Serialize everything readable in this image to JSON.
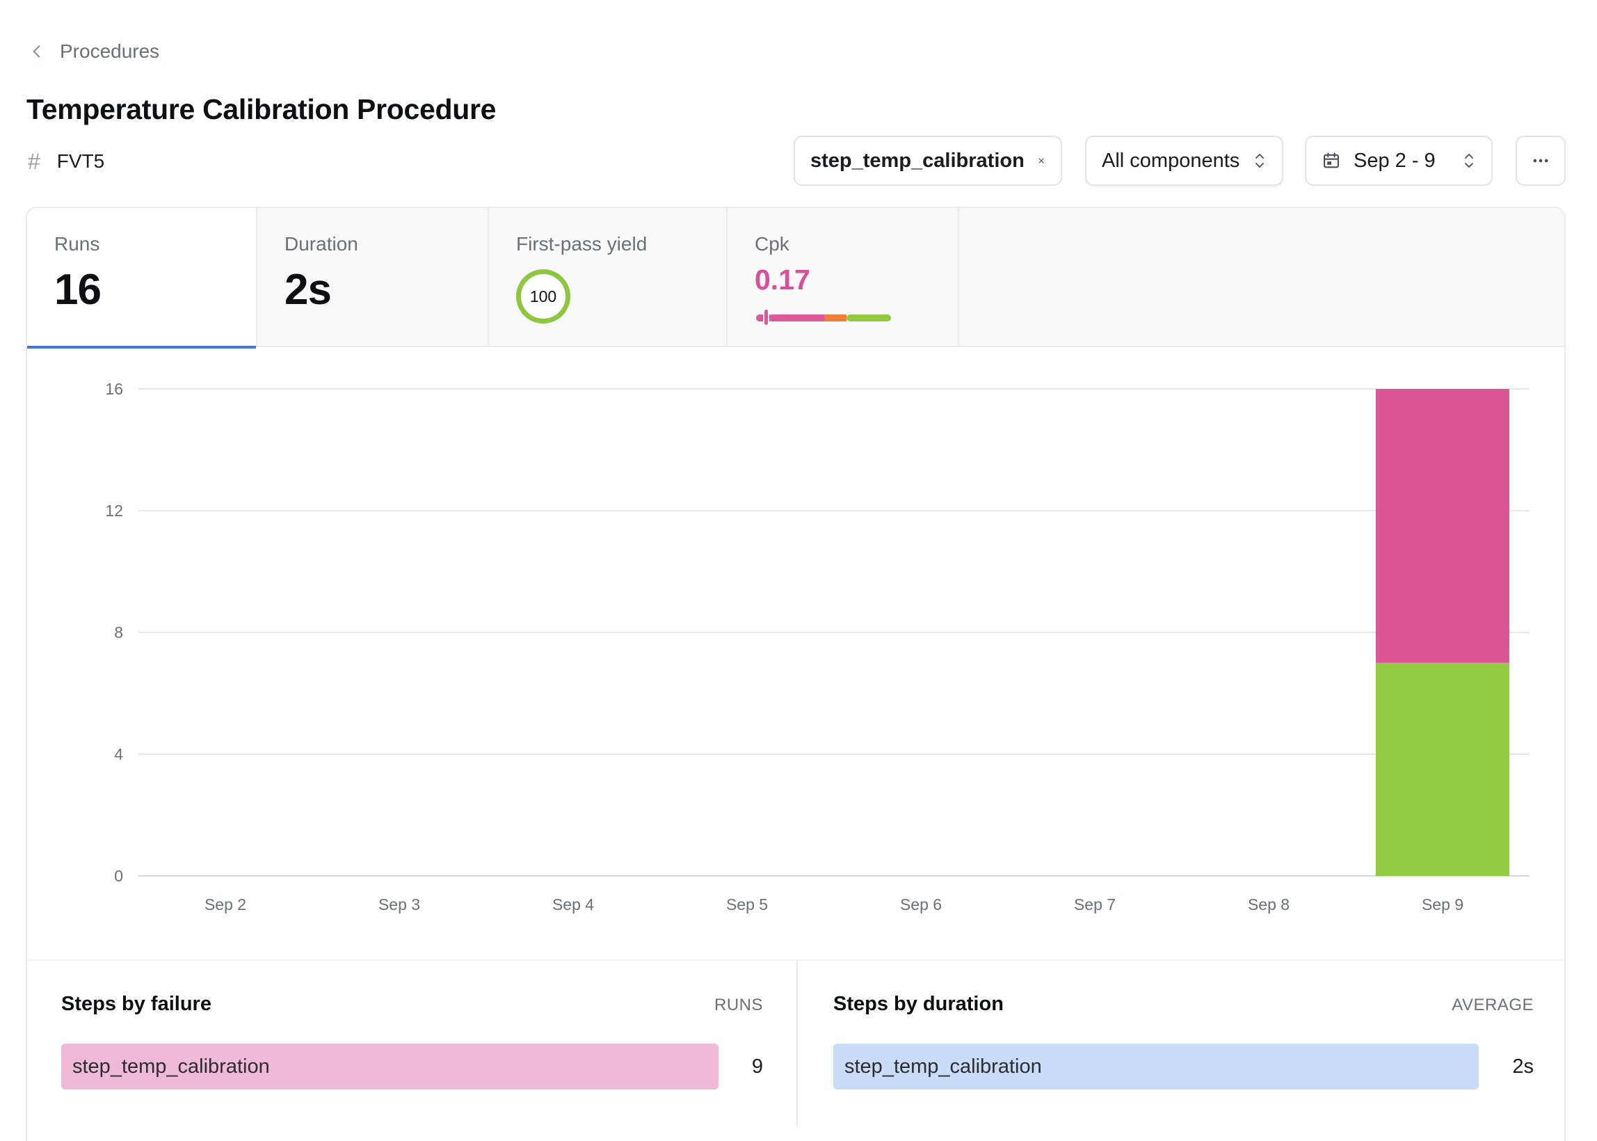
{
  "breadcrumb": {
    "label": "Procedures",
    "icon": "chevron-left-icon"
  },
  "page": {
    "title": "Temperature Calibration Procedure",
    "id_symbol": "#",
    "id": "FVT5"
  },
  "controls": {
    "filter": {
      "label": "step_temp_calibration",
      "icon": "close-icon"
    },
    "components": {
      "label": "All components",
      "icon": "chevron-up-down-icon"
    },
    "dates": {
      "label": "Sep 2 - 9",
      "icon": "calendar-icon"
    },
    "more": {
      "icon": "more-horizontal-icon"
    }
  },
  "metrics": {
    "runs": {
      "label": "Runs",
      "value": "16"
    },
    "duration": {
      "label": "Duration",
      "value": "2s"
    },
    "yield": {
      "label": "First-pass yield",
      "value": "100"
    },
    "cpk": {
      "label": "Cpk",
      "value": "0.17",
      "value_color": "#d9509a"
    }
  },
  "colors": {
    "pass": "#94c942",
    "fail": "#dc5698",
    "accent": "#3b76e1",
    "warn": "#ee7d36"
  },
  "chart_data": {
    "type": "bar",
    "stacked": true,
    "categories": [
      "Sep 2",
      "Sep 3",
      "Sep 4",
      "Sep 5",
      "Sep 6",
      "Sep 7",
      "Sep 8",
      "Sep 9"
    ],
    "series": [
      {
        "values": [
          0,
          0,
          0,
          0,
          0,
          0,
          0,
          7
        ],
        "color": "#94c942"
      },
      {
        "values": [
          0,
          0,
          0,
          0,
          0,
          0,
          0,
          9
        ],
        "color": "#dc5698"
      }
    ],
    "yticks": [
      0,
      4,
      8,
      12,
      16
    ],
    "ylim": [
      0,
      16
    ],
    "grid": true
  },
  "steps_by_failure": {
    "title": "Steps by failure",
    "column": "RUNS",
    "rows": [
      {
        "label": "step_temp_calibration",
        "value": "9"
      }
    ]
  },
  "steps_by_duration": {
    "title": "Steps by duration",
    "column": "AVERAGE",
    "rows": [
      {
        "label": "step_temp_calibration",
        "value": "2s"
      }
    ]
  }
}
